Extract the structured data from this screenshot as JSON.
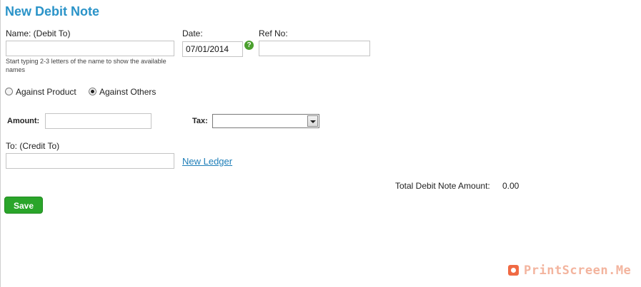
{
  "page": {
    "title": "New Debit Note"
  },
  "form": {
    "name_label": "Name: (Debit To)",
    "name_value": "",
    "name_hint": "Start typing 2-3 letters of the name to show the available names",
    "date_label": "Date:",
    "date_value": "07/01/2014",
    "ref_label": "Ref No:",
    "ref_value": "",
    "radio_product_label": "Against Product",
    "radio_others_label": "Against Others",
    "radio_selected": "Against Others",
    "amount_label": "Amount:",
    "amount_value": "",
    "tax_label": "Tax:",
    "tax_selected": "",
    "credit_to_label": "To: (Credit To)",
    "credit_to_value": "",
    "new_ledger_link": "New Ledger",
    "total_label": "Total Debit Note Amount:",
    "total_value": "0.00",
    "save_label": "Save"
  },
  "icons": {
    "date_help": "help-icon",
    "watermark": "camera-icon"
  },
  "colors": {
    "title": "#2a93c8",
    "save_button": "#2aa52a",
    "link": "#1e7eb8",
    "help_icon": "#4ba02e"
  },
  "watermark": {
    "text": "PrintScreen.Me"
  }
}
